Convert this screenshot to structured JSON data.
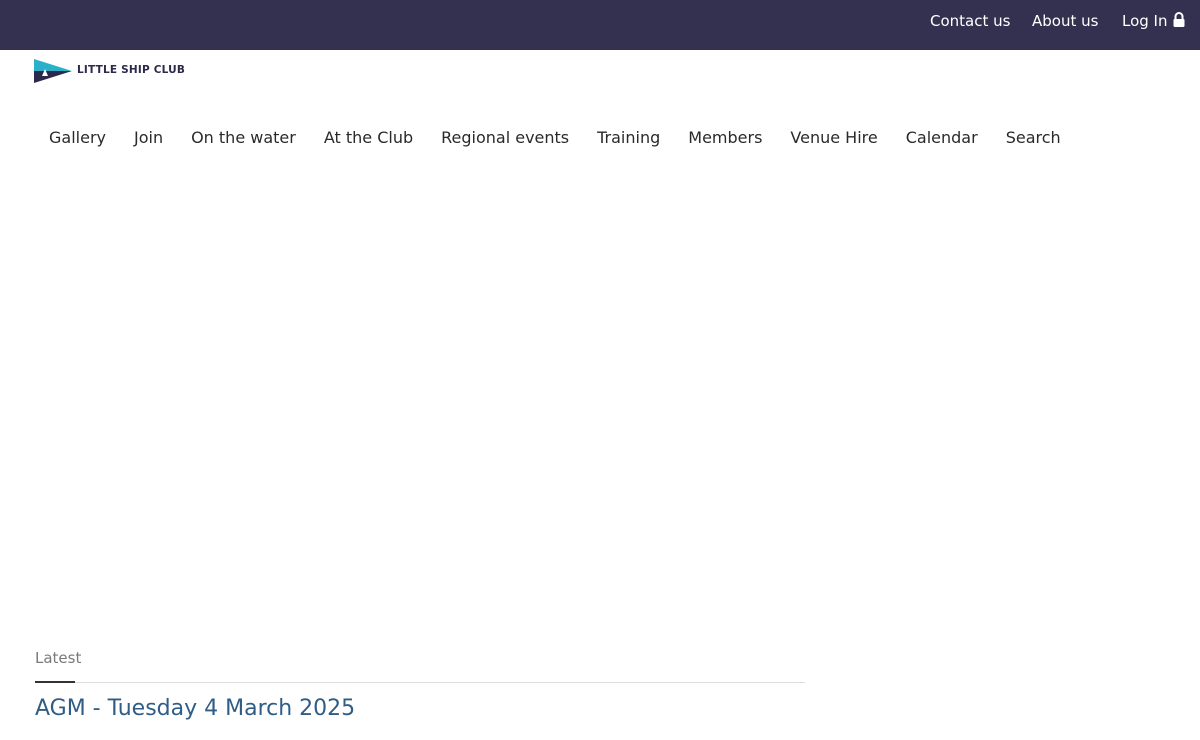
{
  "topbar": {
    "links": [
      "Contact us",
      "About us",
      "Log In"
    ]
  },
  "logo": {
    "text": "LITTLE SHIP CLUB"
  },
  "nav": {
    "items": [
      "Gallery",
      "Join",
      "On the water",
      "At the Club",
      "Regional events",
      "Training",
      "Members",
      "Venue Hire",
      "Calendar",
      "Search"
    ]
  },
  "latest": {
    "label": "Latest",
    "title": "AGM - Tuesday 4 March 2025"
  },
  "colors": {
    "topbar": "#343150",
    "link_blue": "#2f5d86",
    "logo_teal": "#2ab0c8",
    "logo_navy": "#2c2a4a"
  },
  "icons": [
    "lock-icon",
    "pennant-logo-icon"
  ]
}
